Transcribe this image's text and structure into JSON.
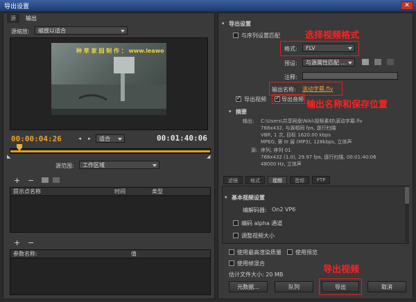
{
  "window": {
    "title": "导出设置",
    "close": "✕"
  },
  "left": {
    "tabs": [
      "源",
      "输出"
    ],
    "scale_label": "源缩放:",
    "scale_value": "缩放以适合",
    "watermark": "种 草 家 园 制 作 ： www.leawo",
    "timecode_current": "00:00:04:26",
    "fit_value": "适合",
    "timecode_total": "00:01:40:06",
    "range_label": "源范围:",
    "range_value": "工作区域",
    "cue_headers": [
      "提示点名称",
      "时间",
      "类型"
    ],
    "param_headers": [
      "参数名称:",
      "值"
    ],
    "add": "+",
    "remove": "−"
  },
  "right": {
    "section_title": "导出设置",
    "match_seq": "与序列设置匹配",
    "format_label": "格式:",
    "format_value": "FLV",
    "preset_label": "预设:",
    "preset_value": "与源属性匹配 ...",
    "notes_label": "注释:",
    "output_name_label": "输出名称:",
    "output_name_value": "滚动字幕.flv",
    "export_video": "导出视频",
    "export_audio": "导出音频",
    "summary_title": "摘要",
    "output_label": "输出:",
    "output_lines": [
      "C:\\Users\\共享网盘\\Niki\\视频素材\\滚动字幕.flv",
      "768x432, 与源相同 fps, 逐行扫描",
      "VBR, 1 次, 目标 1620.00 kbps",
      "MPEG, 第 III 层 (MP3), 128kbps, 立体声"
    ],
    "source_label": "源:",
    "source_lines": [
      "序列, 序列 01",
      "768x432 (1.0), 29.97 fps, 逐行扫描, 00:01:40:06",
      "48000 Hz, 立体声"
    ],
    "subtabs": [
      "滤镜",
      "格式",
      "视频",
      "音频",
      "FTP"
    ],
    "basic_video": "基本视频设置",
    "codec_label": "编解码器:",
    "codec_value": "On2 VP6",
    "alpha": "编码 alpha 通道",
    "resize": "调整视频大小",
    "max_quality": "使用最高渲染质量",
    "use_preview": "使用预览",
    "use_blend": "使用帧混合",
    "filesize": "估计文件大小: 20 MB",
    "btn_metadata": "元数据...",
    "btn_queue": "队列",
    "btn_export": "导出",
    "btn_cancel": "取消"
  },
  "annotations": {
    "select_format": "选择视频格式",
    "output_name": "输出名称和保存位置",
    "export_video": "导出视频"
  }
}
